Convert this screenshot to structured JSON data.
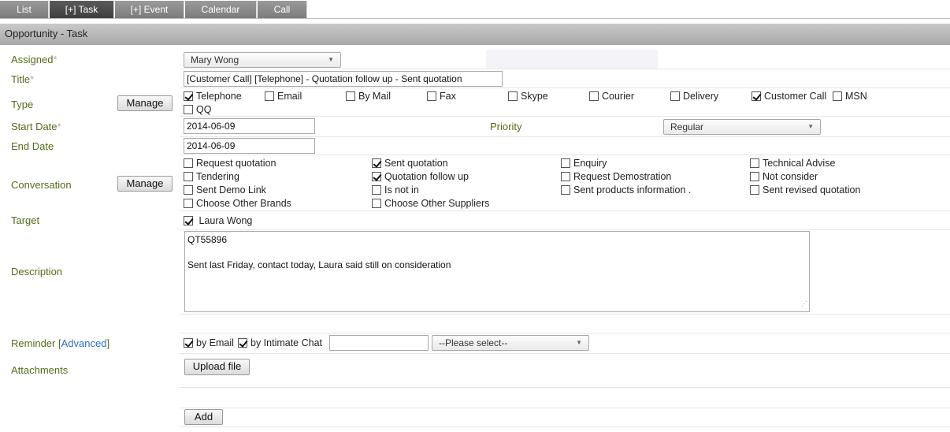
{
  "tabs": [
    "List",
    "[+] Task",
    "[+] Event",
    "Calendar",
    "Call"
  ],
  "header": {
    "title": "Opportunity - Task"
  },
  "labels": {
    "assigned": "Assigned",
    "title": "Title",
    "type": "Type",
    "start_date": "Start Date",
    "end_date": "End Date",
    "conversation": "Conversation",
    "target": "Target",
    "description": "Description",
    "reminder": "Reminder",
    "advanced": "Advanced",
    "attachments": "Attachments",
    "priority": "Priority",
    "required_mark": "*",
    "bracket_open": "[",
    "bracket_close": "]"
  },
  "buttons": {
    "manage": "Manage",
    "upload": "Upload file",
    "add": "Add"
  },
  "fields": {
    "assigned_value": "Mary Wong",
    "title_value": "[Customer Call] [Telephone] - Quotation follow up - Sent quotation",
    "start_date_value": "2014-06-09",
    "end_date_value": "2014-06-09",
    "priority_value": "Regular",
    "reminder_select": "--Please select--",
    "reminder_text": "",
    "description_line1": "QT55896",
    "description_line2": "Sent last Friday, contact today, Laura said still on consideration"
  },
  "types": [
    {
      "label": "Telephone",
      "checked": true
    },
    {
      "label": "Email",
      "checked": false
    },
    {
      "label": "By Mail",
      "checked": false
    },
    {
      "label": "Fax",
      "checked": false
    },
    {
      "label": "Skype",
      "checked": false
    },
    {
      "label": "Courier",
      "checked": false
    },
    {
      "label": "Delivery",
      "checked": false
    },
    {
      "label": "Customer Call",
      "checked": true
    },
    {
      "label": "MSN",
      "checked": false
    },
    {
      "label": "QQ",
      "checked": false
    }
  ],
  "conversations": [
    {
      "label": "Request quotation",
      "checked": false
    },
    {
      "label": "Sent quotation",
      "checked": true
    },
    {
      "label": "Enquiry",
      "checked": false
    },
    {
      "label": "Technical Advise",
      "checked": false
    },
    {
      "label": "Tendering",
      "checked": false
    },
    {
      "label": "Quotation follow up",
      "checked": true
    },
    {
      "label": "Request Demostration",
      "checked": false
    },
    {
      "label": "Not consider",
      "checked": false
    },
    {
      "label": "Sent Demo Link",
      "checked": false
    },
    {
      "label": "Is not in",
      "checked": false
    },
    {
      "label": "Sent products information .",
      "checked": false
    },
    {
      "label": "Sent revised quotation",
      "checked": false
    },
    {
      "label": "Choose Other Brands",
      "checked": false
    },
    {
      "label": "Choose Other Suppliers",
      "checked": false
    }
  ],
  "target": {
    "label": "Laura Wong",
    "checked": true
  },
  "reminders": [
    {
      "label": "by Email",
      "checked": true
    },
    {
      "label": "by Intimate Chat",
      "checked": true
    }
  ],
  "icons": {
    "dropdown": "dropdown-arrow-icon",
    "checkmark": "checkmark-icon",
    "resize": "resize-grip-icon"
  }
}
